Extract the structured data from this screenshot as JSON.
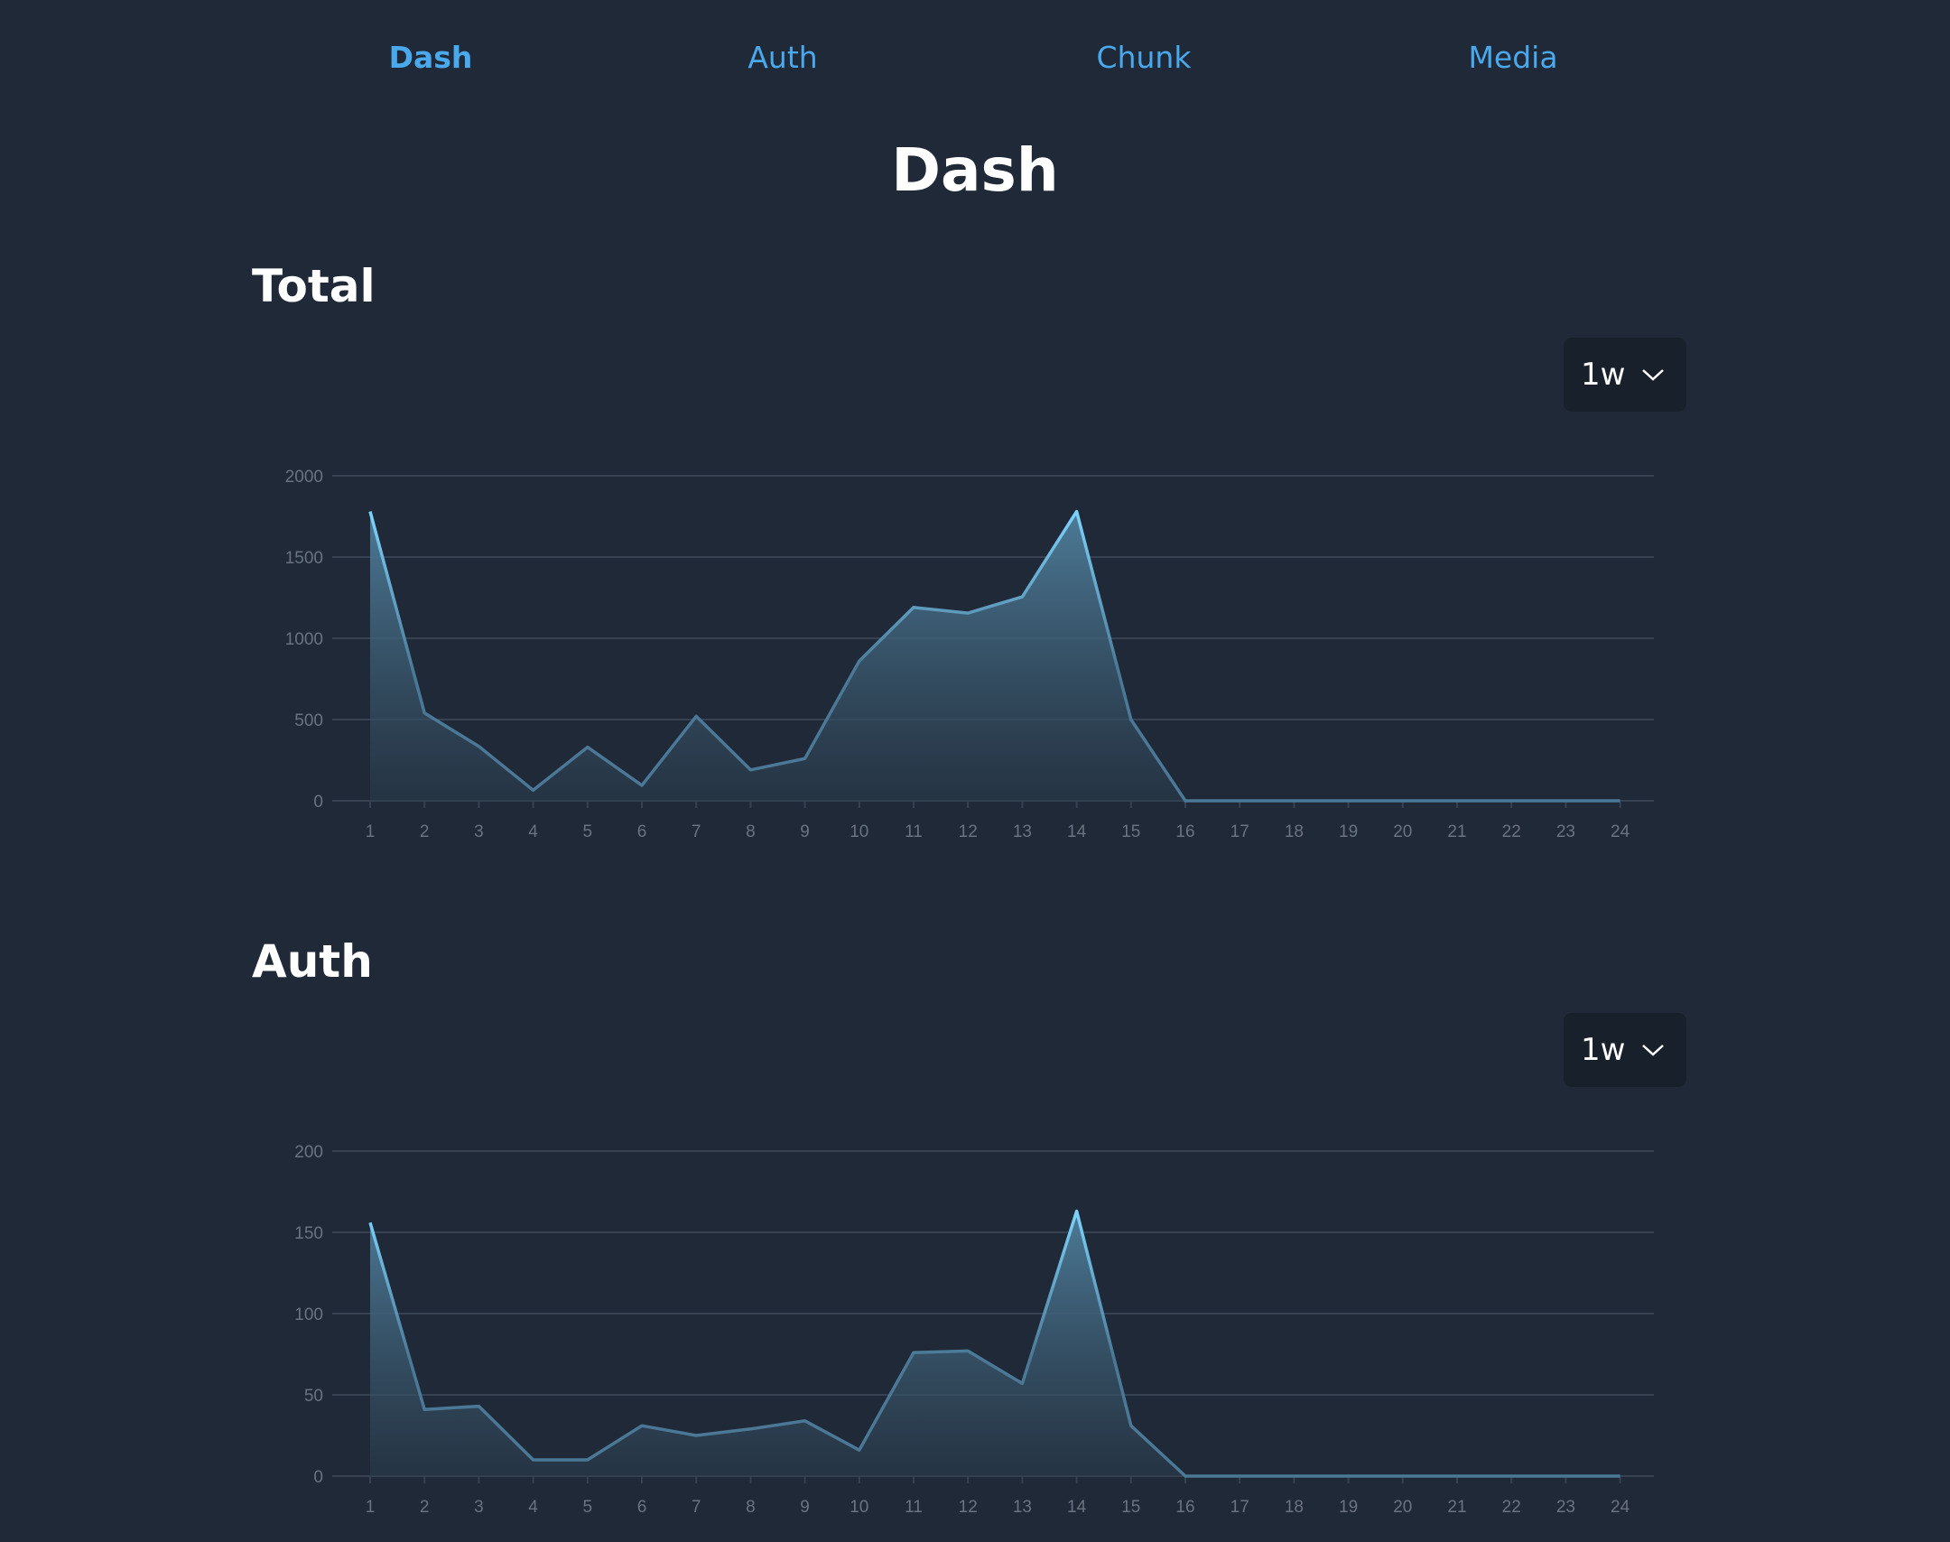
{
  "nav": {
    "items": [
      {
        "label": "Dash",
        "active": true
      },
      {
        "label": "Auth",
        "active": false
      },
      {
        "label": "Chunk",
        "active": false
      },
      {
        "label": "Media",
        "active": false
      }
    ]
  },
  "page": {
    "title": "Dash"
  },
  "sections": [
    {
      "title": "Total",
      "range": "1w"
    },
    {
      "title": "Auth",
      "range": "1w"
    }
  ],
  "colors": {
    "background": "#1f2937",
    "nav_link": "#4aa8ec",
    "line_active": "#7dd3fc",
    "line_muted": "#4b7896",
    "select_bg": "#18202b"
  },
  "icons": {
    "select_chevron": "chevron-down-icon"
  },
  "chart_data": [
    {
      "type": "area",
      "x": [
        "1",
        "2",
        "3",
        "4",
        "5",
        "6",
        "7",
        "8",
        "9",
        "10",
        "11",
        "12",
        "13",
        "14",
        "15",
        "16",
        "17",
        "18",
        "19",
        "20",
        "21",
        "22",
        "23",
        "24"
      ],
      "values": [
        1780,
        540,
        335,
        65,
        330,
        95,
        520,
        190,
        260,
        860,
        1190,
        1155,
        1255,
        1780,
        500,
        0,
        0,
        0,
        0,
        0,
        0,
        0,
        0,
        0
      ],
      "yticks": [
        "0",
        "500",
        "1000",
        "1500",
        "2000"
      ],
      "ylim": [
        0,
        2000
      ],
      "grid": true
    },
    {
      "type": "area",
      "x": [
        "1",
        "2",
        "3",
        "4",
        "5",
        "6",
        "7",
        "8",
        "9",
        "10",
        "11",
        "12",
        "13",
        "14",
        "15",
        "16",
        "17",
        "18",
        "19",
        "20",
        "21",
        "22",
        "23",
        "24"
      ],
      "values": [
        156,
        41,
        43,
        10,
        10,
        31,
        25,
        29,
        34,
        16,
        76,
        77,
        57,
        163,
        31,
        0,
        0,
        0,
        0,
        0,
        0,
        0,
        0,
        0
      ],
      "yticks": [
        "0",
        "50",
        "100",
        "150",
        "200"
      ],
      "ylim": [
        0,
        200
      ],
      "grid": true
    }
  ]
}
